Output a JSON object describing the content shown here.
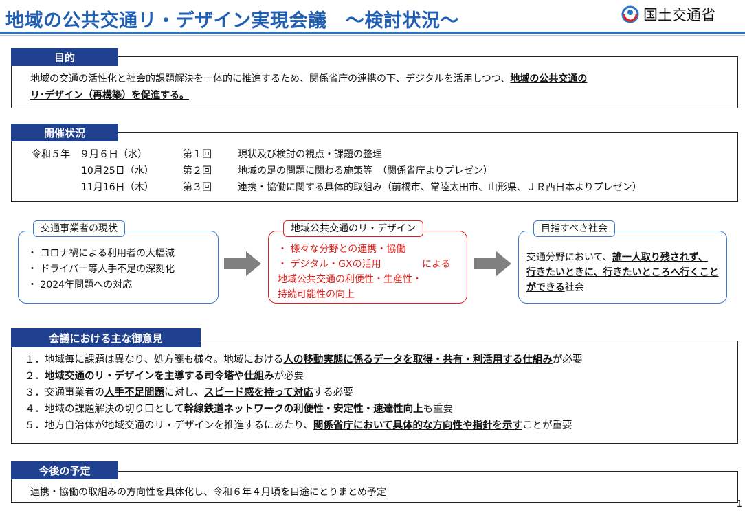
{
  "header": {
    "title": "地域の公共交通リ・デザイン実現会議　～検討状況～",
    "brand": "国土交通省"
  },
  "purpose": {
    "tab": "目的",
    "line1_plain": "地域の交通の活性化と社会的課題解決を一体的に推進するため、関係省庁の連携の下、デジタルを活用しつつ、",
    "line1_emph": "地域の公共交通の",
    "line2_emph": "リ･デザイン（再構築）を促進する。"
  },
  "status": {
    "tab": "開催状況",
    "meetings": [
      {
        "date": "令和５年　９月６日（水）",
        "num": "第１回",
        "topic": "現状及び検討の視点・課題の整理"
      },
      {
        "date": "10月25日（水）",
        "num": "第２回",
        "topic": "地域の足の問題に関わる施策等　（関係省庁よりプレゼン）"
      },
      {
        "date": "11月16日（木）",
        "num": "第３回",
        "topic": "連携・協働に関する具体的取組み（前橋市、常陸太田市、山形県、ＪＲ西日本よりプレゼン）"
      }
    ]
  },
  "flow": {
    "current": {
      "label": "交通事業者の現状",
      "items": [
        "・ コロナ禍による利用者の大幅減",
        "・ ドライバー等人手不足の深刻化",
        "・ 2024年問題への対応"
      ]
    },
    "redesign": {
      "label": "地域公共交通のリ・デザイン",
      "line1": "・ 様々な分野との連携・協働",
      "line2a": "・ デジタル・GXの活用",
      "line2b": "による",
      "line3": "地域公共交通の利便性・生産性・",
      "line4": "持続可能性の向上"
    },
    "goal": {
      "label": "目指すべき社会",
      "line1_plain": "交通分野において、",
      "line1_emph": "誰一人取り残されず、",
      "line2_emph": "行きたいときに、行きたいところへ行くこと",
      "line3_emph": "ができる",
      "line3_plain": "社会"
    }
  },
  "opinions": {
    "tab": "会議における主な御意見",
    "items": [
      {
        "num": "１．",
        "parts": [
          {
            "t": "地域毎に課題は異なり、処方箋も様々。地域における"
          },
          {
            "t": "人の移動実態に係るデータを取得・共有・利活用する仕組み",
            "u": true
          },
          {
            "t": "が必要"
          }
        ]
      },
      {
        "num": "２．",
        "parts": [
          {
            "t": "地域交通のリ・デザインを主導する司令塔や仕組み",
            "u": true
          },
          {
            "t": "が必要"
          }
        ]
      },
      {
        "num": "３．",
        "parts": [
          {
            "t": "交通事業者の"
          },
          {
            "t": "人手不足問題",
            "u": true
          },
          {
            "t": "に対し、"
          },
          {
            "t": "スピード感を持って対応",
            "u": true
          },
          {
            "t": "する必要"
          }
        ]
      },
      {
        "num": "４．",
        "parts": [
          {
            "t": "地域の課題解決の切り口として"
          },
          {
            "t": "幹線鉄道ネットワークの利便性・安定性・速達性向上",
            "u": true
          },
          {
            "t": "も重要"
          }
        ]
      },
      {
        "num": "５．",
        "parts": [
          {
            "t": "地方自治体が地域交通のリ・デザインを推進するにあたり、"
          },
          {
            "t": "関係省庁において具体的な方向性や指針を示す",
            "u": true
          },
          {
            "t": "ことが重要"
          }
        ]
      }
    ]
  },
  "future": {
    "tab": "今後の予定",
    "text": "連携・協働の取組みの方向性を具体化し、令和６年４月頃を目途にとりまとめ予定"
  },
  "page_number": "1",
  "colors": {
    "title_blue": "#1f5fb4",
    "tab_navy": "#1f3f8f",
    "flow_blue": "#3b7ad0",
    "flow_red": "#e0201a"
  }
}
